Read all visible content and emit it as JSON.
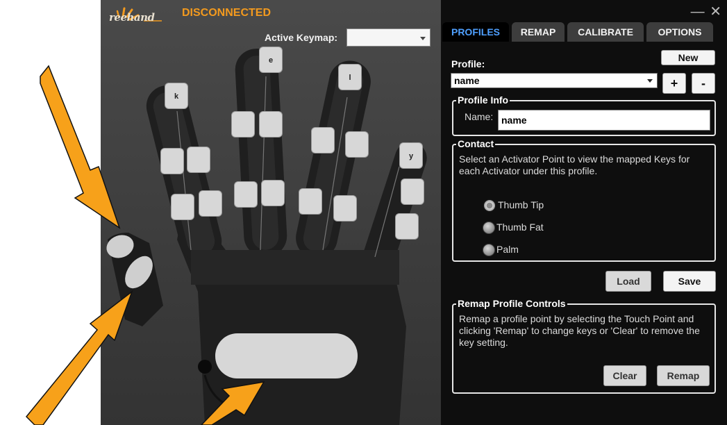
{
  "app": {
    "logo_text": "reehand",
    "status": "DISCONNECTED",
    "active_keymap_label": "Active Keymap:",
    "active_keymap_value": "",
    "window_controls": {
      "minimize": "—",
      "close": "✕"
    }
  },
  "tabs": [
    {
      "label": "PROFILES",
      "active": true
    },
    {
      "label": "REMAP",
      "active": false
    },
    {
      "label": "CALIBRATE",
      "active": false
    },
    {
      "label": "OPTIONS",
      "active": false
    }
  ],
  "profile": {
    "label": "Profile:",
    "new_button": "New",
    "selected": "name",
    "add_button": "+",
    "remove_button": "-"
  },
  "profile_info": {
    "legend": "Profile Info",
    "name_label": "Name:",
    "name_value": "name"
  },
  "contact": {
    "legend": "Contact",
    "description": "Select an Activator Point to view the mapped Keys for each Activator under this profile.",
    "options": [
      {
        "label": "Thumb Tip",
        "selected": true
      },
      {
        "label": "Thumb Fat",
        "selected": false
      },
      {
        "label": "Palm",
        "selected": false
      }
    ]
  },
  "actions": {
    "load_button": "Load",
    "save_button": "Save"
  },
  "remap_controls": {
    "legend": "Remap Profile Controls",
    "description": "Remap a profile point by selecting the Touch Point and clicking 'Remap' to change keys or 'Clear' to remove the key setting.",
    "clear_button": "Clear",
    "remap_button": "Remap"
  },
  "hand_keys": {
    "k": "k",
    "e": "e",
    "l": "l",
    "y": "y"
  },
  "colors": {
    "status": "#f39a1e",
    "active_tab": "#4fa0ff",
    "arrow": "#f7a11a"
  }
}
